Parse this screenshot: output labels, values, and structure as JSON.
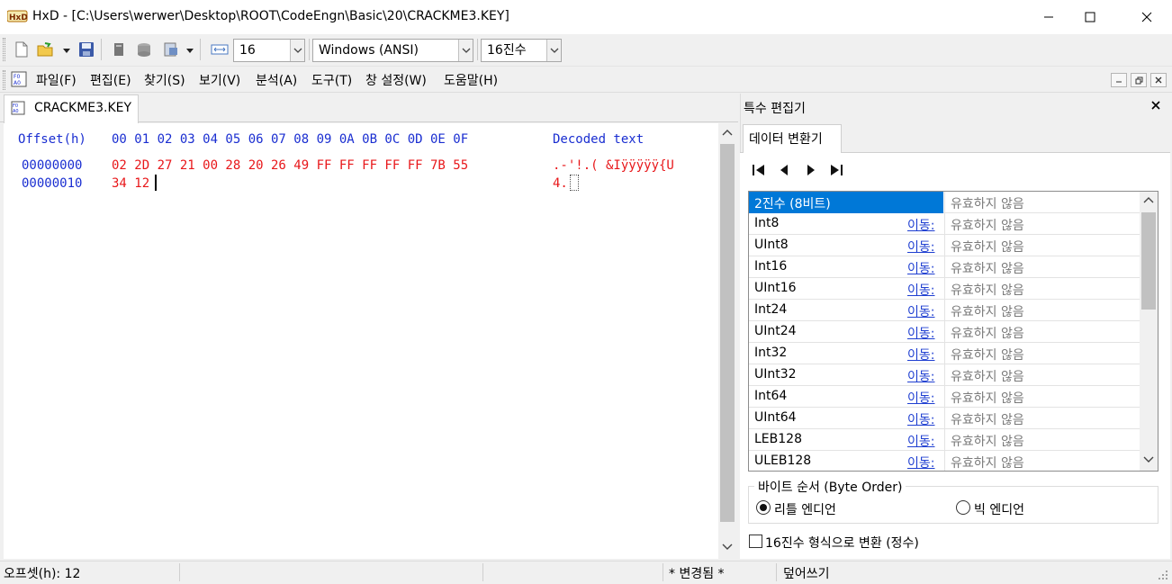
{
  "window": {
    "icon_text": "HxD",
    "title": "HxD - [C:\\Users\\werwer\\Desktop\\ROOT\\CodeEngn\\Basic\\20\\CRACKME3.KEY]"
  },
  "toolbar": {
    "bytes_per_row": "16",
    "charset": "Windows (ANSI)",
    "offset_base": "16진수"
  },
  "menu": {
    "items": [
      "파일(F)",
      "편집(E)",
      "찾기(S)",
      "보기(V)",
      "분석(A)",
      "도구(T)",
      "창 설정(W)",
      "도움말(H)"
    ]
  },
  "document": {
    "tab_label": "CRACKME3.KEY",
    "header": {
      "offset": "Offset(h)",
      "columns": "00 01 02 03 04 05 06 07 08 09 0A 0B 0C 0D 0E 0F",
      "decoded": "Decoded text"
    },
    "rows": [
      {
        "offset": "00000000",
        "hex": "02 2D 27 21 00 28 20 26 49 FF FF FF FF FF 7B 55",
        "text": ".-'!.( &Iÿÿÿÿÿ{U"
      },
      {
        "offset": "00000010",
        "hex": "34 12",
        "text": "4."
      }
    ]
  },
  "inspector": {
    "title": "특수 편집기",
    "tab_label": "데이터 변환기",
    "go_label": "이동:",
    "rows": [
      {
        "name": "2진수 (8비트)",
        "value": "유효하지 않음",
        "selected": true
      },
      {
        "name": "Int8",
        "value": "유효하지 않음"
      },
      {
        "name": "UInt8",
        "value": "유효하지 않음"
      },
      {
        "name": "Int16",
        "value": "유효하지 않음"
      },
      {
        "name": "UInt16",
        "value": "유효하지 않음"
      },
      {
        "name": "Int24",
        "value": "유효하지 않음"
      },
      {
        "name": "UInt24",
        "value": "유효하지 않음"
      },
      {
        "name": "Int32",
        "value": "유효하지 않음"
      },
      {
        "name": "UInt32",
        "value": "유효하지 않음"
      },
      {
        "name": "Int64",
        "value": "유효하지 않음"
      },
      {
        "name": "UInt64",
        "value": "유효하지 않음"
      },
      {
        "name": "LEB128",
        "value": "유효하지 않음"
      },
      {
        "name": "ULEB128",
        "value": "유효하지 않음"
      }
    ],
    "byte_order": {
      "legend": "바이트 순서 (Byte Order)",
      "little": "리틀 엔디언",
      "big": "빅 엔디언",
      "selected": "little"
    },
    "hex_checkbox": "16진수 형식으로 변환 (정수)"
  },
  "status": {
    "offset": "오프셋(h): 12",
    "modified": "* 변경됨 *",
    "mode": "덮어쓰기"
  },
  "colors": {
    "header_blue": "#1a2ed1",
    "modified_red": "#e8171a",
    "selection": "#0078d7",
    "link": "#1f3fd1"
  }
}
